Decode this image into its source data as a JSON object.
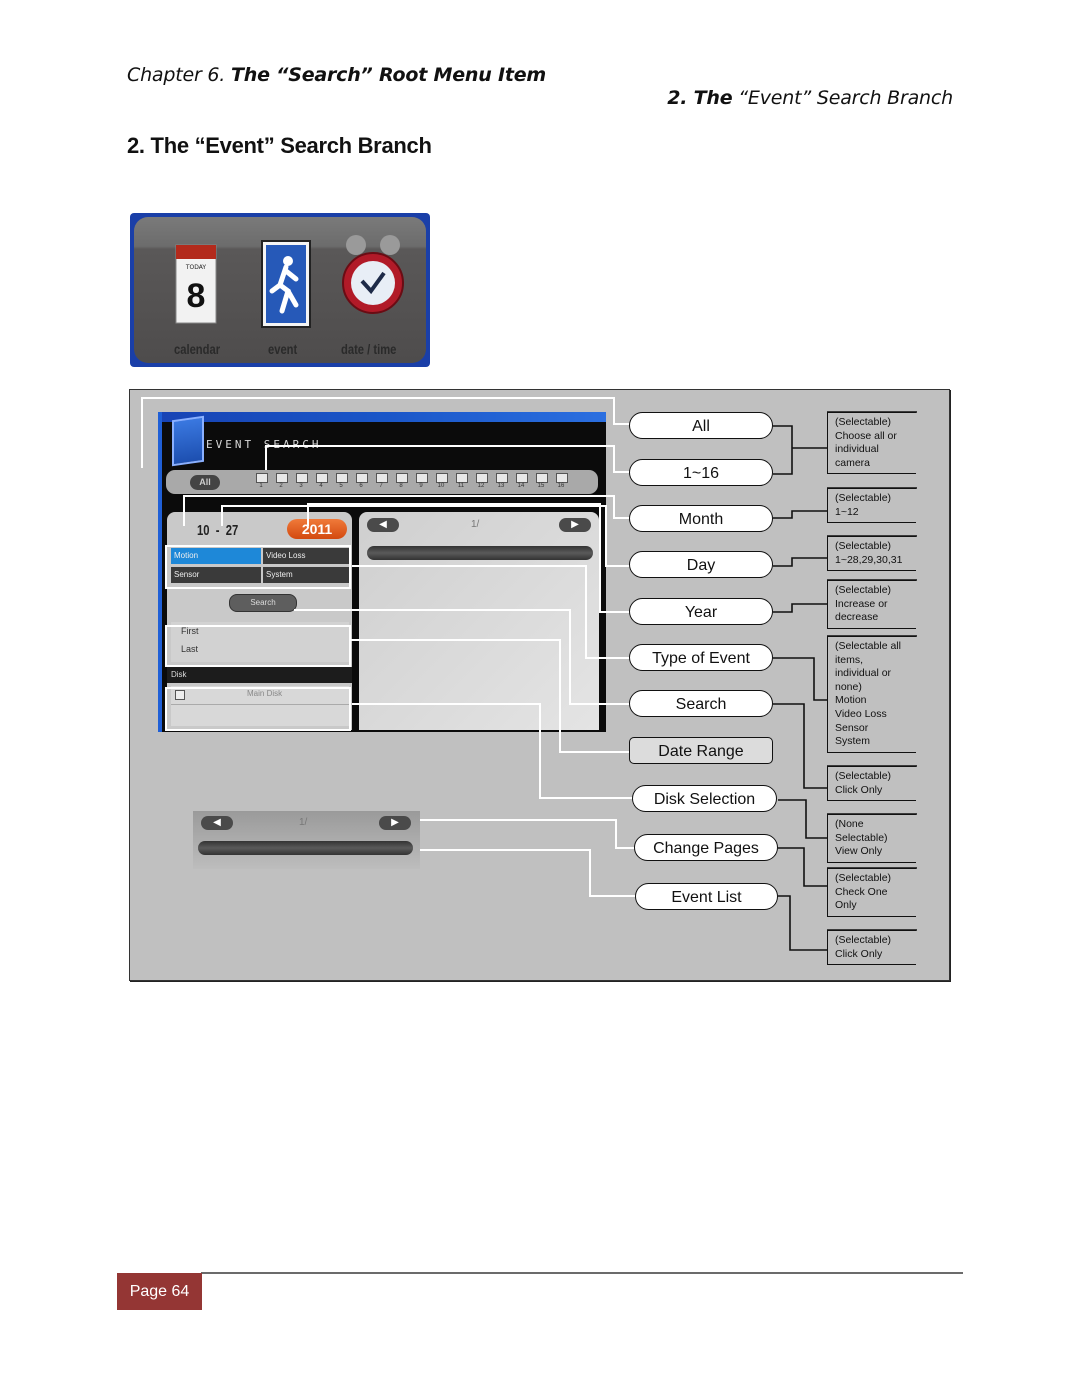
{
  "header": {
    "chapter_prefix": "Chapter 6.",
    "chapter_title": "The “Search” Root Menu Item",
    "section_prefix": "2. The",
    "section_title": "“Event” Search Branch"
  },
  "page_heading": "2. The “Event” Search Branch",
  "menu_screenshot": {
    "items": [
      {
        "label": "calendar",
        "icon": "calendar-icon",
        "day": "8",
        "tag": "TODAY"
      },
      {
        "label": "event",
        "icon": "running-man-icon"
      },
      {
        "label": "date / time",
        "icon": "alarm-clock-icon"
      }
    ]
  },
  "dvr_screen": {
    "title": "EVENT SEARCH",
    "all_button": "All",
    "cameras": [
      "1",
      "2",
      "3",
      "4",
      "5",
      "6",
      "7",
      "8",
      "9",
      "10",
      "11",
      "12",
      "13",
      "14",
      "15",
      "16"
    ],
    "month": "10",
    "separator": "-",
    "day": "27",
    "year": "2011",
    "event_types": [
      {
        "label": "Motion",
        "selected": true
      },
      {
        "label": "Video Loss",
        "selected": false
      },
      {
        "label": "Sensor",
        "selected": false
      },
      {
        "label": "System",
        "selected": false
      }
    ],
    "search_button": "Search",
    "range_first": "First",
    "range_last": "Last",
    "disk_header": "Disk",
    "disk_item": "Main Disk",
    "page_prev": "◀",
    "page_next": "▶",
    "page_indicator": "1/"
  },
  "callouts": [
    {
      "label": "All"
    },
    {
      "label": "1~16"
    },
    {
      "label": "Month"
    },
    {
      "label": "Day"
    },
    {
      "label": "Year"
    },
    {
      "label": "Type of Event"
    },
    {
      "label": "Search"
    },
    {
      "label": "Date Range"
    },
    {
      "label": "Disk Selection"
    },
    {
      "label": "Change Pages"
    },
    {
      "label": "Event List"
    }
  ],
  "descriptions": [
    {
      "lines": [
        "(Selectable)",
        "Choose all or",
        "individual",
        "camera"
      ]
    },
    {
      "lines": [
        "(Selectable)",
        "1~12"
      ]
    },
    {
      "lines": [
        "(Selectable)",
        "1~28,29,30,31"
      ]
    },
    {
      "lines": [
        "(Selectable)",
        "Increase or",
        "decrease"
      ]
    },
    {
      "lines": [
        "(Selectable all",
        "items,",
        "individual or",
        "none)",
        "Motion",
        "Video Loss",
        "Sensor",
        "System"
      ]
    },
    {
      "lines": [
        "(Selectable)",
        "Click Only"
      ]
    },
    {
      "lines": [
        "(None",
        "Selectable)",
        "View Only"
      ]
    },
    {
      "lines": [
        "(Selectable)",
        "Check One",
        "Only"
      ]
    },
    {
      "lines": [
        "(Selectable)",
        "Click Only"
      ]
    }
  ],
  "footer": {
    "page_label": "Page 64"
  },
  "colors": {
    "page_badge": "#943634",
    "diagram_bg": "#c0c0c0",
    "year_pill": "#e0561b",
    "motion_selected": "#1e88d8"
  }
}
